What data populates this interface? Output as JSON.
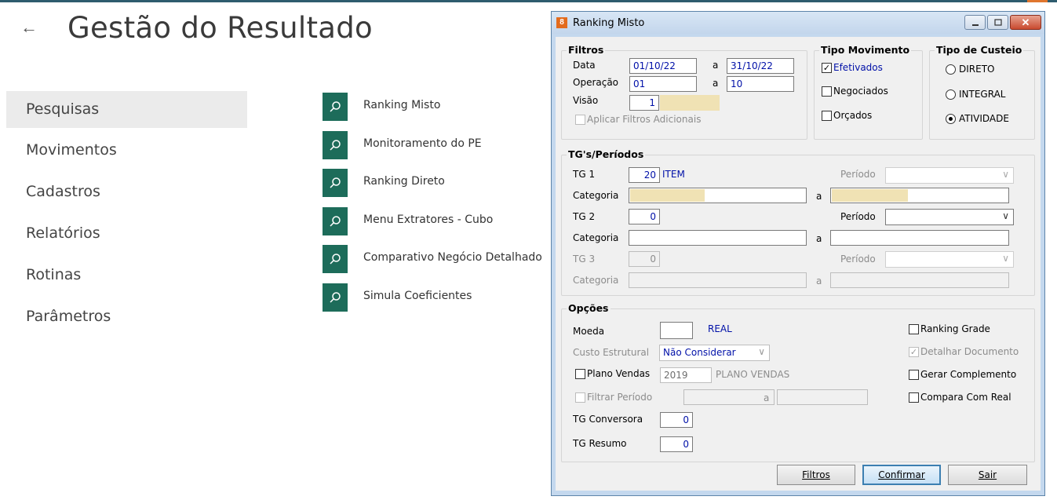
{
  "app": {
    "back_glyph": "←",
    "title": "Gestão do Resultado"
  },
  "nav": [
    {
      "label": "Pesquisas"
    },
    {
      "label": "Movimentos"
    },
    {
      "label": "Cadastros"
    },
    {
      "label": "Relatórios"
    },
    {
      "label": "Rotinas"
    },
    {
      "label": "Parâmetros"
    }
  ],
  "menu": [
    {
      "label": "Ranking Misto",
      "icon": "search-icon"
    },
    {
      "label": "Monitoramento do PE",
      "icon": "search-icon"
    },
    {
      "label": "Ranking Direto",
      "icon": "search-icon"
    },
    {
      "label": "Menu Extratores - Cubo",
      "icon": "search-icon"
    },
    {
      "label": "Comparativo Negócio Detalhado",
      "icon": "search-icon"
    },
    {
      "label": "Simula Coeficientes",
      "icon": "search-icon"
    }
  ],
  "dialog": {
    "title": "Ranking Misto",
    "icon_glyph": "8",
    "close_glyph": "✕",
    "filtros": {
      "title": "Filtros",
      "data_label": "Data",
      "data_from": "01/10/22",
      "data_to": "31/10/22",
      "a": "a",
      "operacao_label": "Operação",
      "op_from": "01",
      "op_to": "10",
      "visao_label": "Visão",
      "visao_value": "1",
      "aplicar_label": "Aplicar Filtros Adicionais"
    },
    "tipo_movimento": {
      "title": "Tipo Movimento",
      "efetivados": "Efetivados",
      "negociados": "Negociados",
      "orcados": "Orçados",
      "check_glyph": "✓"
    },
    "tipo_custeio": {
      "title": "Tipo de Custeio",
      "direto": "DIRETO",
      "integral": "INTEGRAL",
      "atividade": "ATIVIDADE"
    },
    "tgs": {
      "title": "TG's/Períodos",
      "tg1_label": "TG 1",
      "tg1_value": "20",
      "tg1_desc": "ITEM",
      "tg2_label": "TG 2",
      "tg2_value": "0",
      "tg3_label": "TG 3",
      "tg3_value": "0",
      "categoria_label": "Categoria",
      "periodo_label": "Período",
      "a": "a",
      "chevron": "∨"
    },
    "opcoes": {
      "title": "Opções",
      "moeda_label": "Moeda",
      "moeda_desc": "REAL",
      "custo_label": "Custo Estrutural",
      "custo_value": "Não Considerar",
      "plano_label": "Plano Vendas",
      "plano_year": "2019",
      "plano_desc": "PLANO VENDAS",
      "filtrar_label": "Filtrar Período",
      "a": "a",
      "tgconv_label": "TG Conversora",
      "tgconv_value": "0",
      "tgres_label": "TG Resumo",
      "tgres_value": "0",
      "ranking_grade": "Ranking Grade",
      "detalhar": "Detalhar Documento",
      "gerar": "Gerar Complemento",
      "compara": "Compara Com Real"
    },
    "buttons": {
      "filtros": "Filtros",
      "confirmar": "Confirmar",
      "sair": "Sair"
    }
  }
}
